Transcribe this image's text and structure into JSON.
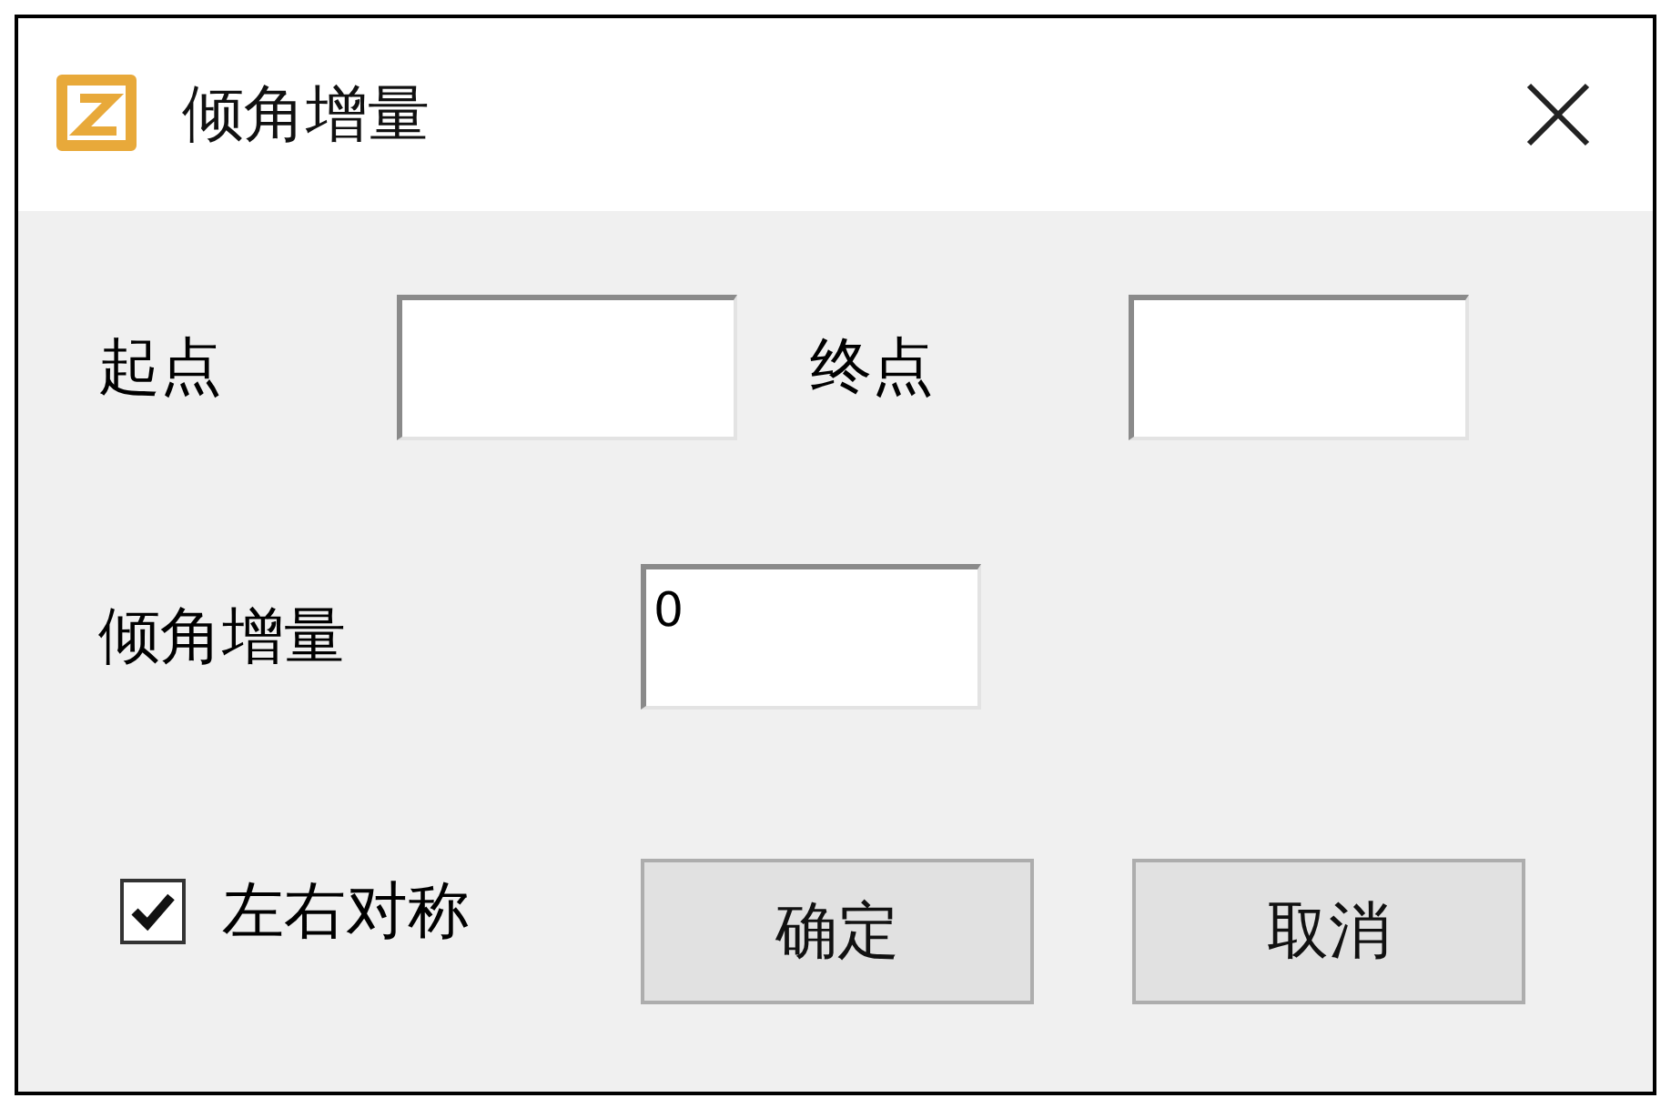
{
  "window": {
    "title": "倾角增量"
  },
  "row": [
    {
      "label": "起点"
    },
    {
      "label": "终点"
    }
  ],
  "increment": {
    "label": "倾角增量",
    "value": "0"
  },
  "checkbox": {
    "label": "左右对称",
    "checked": true
  },
  "buttons": [
    "确定",
    "取消"
  ]
}
